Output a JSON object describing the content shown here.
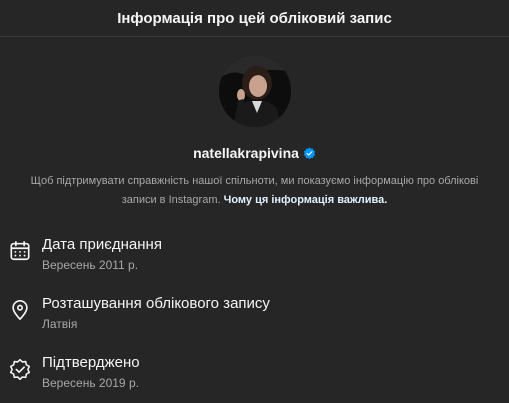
{
  "header": {
    "title": "Інформація про цей обліковий запис"
  },
  "profile": {
    "username": "natellakrapivina",
    "description": "Щоб підтримувати справжність нашої спільноти, ми показуємо інформацію про облікові записи в Instagram.",
    "learn_more": "Чому ця інформація важлива."
  },
  "info": [
    {
      "icon": "calendar-icon",
      "title": "Дата приєднання",
      "value": "Вересень 2011 р."
    },
    {
      "icon": "location-pin-icon",
      "title": "Розташування облікового запису",
      "value": "Латвія"
    },
    {
      "icon": "verified-badge-icon",
      "title": "Підтверджено",
      "value": "Вересень 2019 р."
    }
  ],
  "colors": {
    "background": "#262626",
    "verified_blue": "#0095f6",
    "secondary_text": "#a8a8a8"
  }
}
